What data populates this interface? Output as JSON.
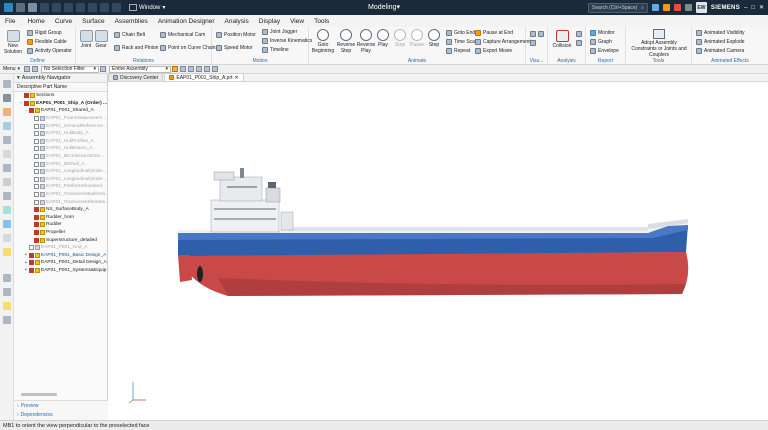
{
  "titlebar": {
    "window_menu": "Window",
    "app_mode": "Modeling",
    "search_placeholder": "Search (Ctrl+Space)",
    "user_initials": "EW",
    "brand": "SIEMENS"
  },
  "menu": [
    "File",
    "Home",
    "Curve",
    "Surface",
    "Assemblies",
    "Animation Designer",
    "Analysis",
    "Display",
    "View",
    "Tools"
  ],
  "ribbon": {
    "define": {
      "label": "Define",
      "new_solution": "New Solution",
      "rigid_group": "Rigid Group",
      "flexible_cable": "Flexible Cable",
      "activity_operator": "Activity Operator"
    },
    "relations": {
      "label": "Relations",
      "joint": "Joint",
      "gear": "Gear",
      "chain_belt": "Chain Belt",
      "rack_pinion": "Rack and Pinion",
      "mechanical_cam": "Mechanical Cam",
      "point_on_curve_chain": "Point on Curve Chain"
    },
    "motion": {
      "label": "Motion",
      "position_motor": "Position Motor",
      "speed_motor": "Speed Motor",
      "joint_jogger": "Joint Jogger",
      "inverse_kinematics": "Inverse Kinematics",
      "timeline": "Timeline"
    },
    "animate": {
      "label": "Animate",
      "goto_beginning": "Goto Beginning",
      "reverse_step": "Reverse Step",
      "reverse_play": "Reverse Play",
      "play": "Play",
      "stop": "Stop",
      "pause": "Pause",
      "step": "Step",
      "goto_end": "Goto End",
      "time_scale": "Time Scale",
      "repeat": "Repeat",
      "pause_at_end": "Pause at End",
      "capture_arrangement": "Capture Arrangement",
      "export_movie": "Export Movie"
    },
    "visualization": {
      "label": "Visu..."
    },
    "analysis": {
      "label": "Analysis",
      "collision": "Collision"
    },
    "report": {
      "label": "Report",
      "monitor": "Monitor",
      "graph": "Graph",
      "envelope": "Envelope"
    },
    "tools": {
      "label": "Tools",
      "adopt": "Adopt Assembly Constraints or Joints and Couplers"
    },
    "animated_effects": {
      "label": "Animated Effects",
      "visibility": "Animated Visibility",
      "explode": "Animated Explode",
      "camera": "Animated Camera"
    }
  },
  "selection_bar": {
    "menu": "Menu",
    "filter": "No Selection Filter",
    "scope": "Entire Assembly"
  },
  "navigator": {
    "title": "Assembly Navigator",
    "column": "Descriptive Part Name",
    "rows": [
      {
        "label": "Sections",
        "indent": 1,
        "state": "normal",
        "toggle": ""
      },
      {
        "label": "EAP01_P001_Ship_A (Order) ...",
        "indent": 1,
        "state": "bold",
        "toggle": "-"
      },
      {
        "label": "EAP01_P001_Shared_A",
        "indent": 2,
        "state": "normal",
        "toggle": "-"
      },
      {
        "label": "EAP01_FrameDataAssem...",
        "indent": 3,
        "state": "dim",
        "toggle": ""
      },
      {
        "label": "EAP01_GeneralReference...",
        "indent": 3,
        "state": "dim",
        "toggle": ""
      },
      {
        "label": "EAP01_HullBody_A",
        "indent": 3,
        "state": "dim",
        "toggle": ""
      },
      {
        "label": "EAP01_HullProfiles_A",
        "indent": 3,
        "state": "dim",
        "toggle": ""
      },
      {
        "label": "EAP01_HullBeams_A",
        "indent": 3,
        "state": "dim",
        "toggle": ""
      },
      {
        "label": "EAP01_IBCrossSectDom...",
        "indent": 3,
        "state": "dim",
        "toggle": ""
      },
      {
        "label": "EAP01_IBShell_A",
        "indent": 3,
        "state": "dim",
        "toggle": ""
      },
      {
        "label": "EAP01_LongitudinalGirder...",
        "indent": 3,
        "state": "dim",
        "toggle": ""
      },
      {
        "label": "EAP01_LongitudinalGirder...",
        "indent": 3,
        "state": "dim",
        "toggle": ""
      },
      {
        "label": "EAP01_PlatformSheetand...",
        "indent": 3,
        "state": "dim",
        "toggle": ""
      },
      {
        "label": "EAP01_TransverseBulkhea...",
        "indent": 3,
        "state": "dim",
        "toggle": ""
      },
      {
        "label": "EAP01_TransverseSheetas...",
        "indent": 3,
        "state": "dim",
        "toggle": ""
      },
      {
        "label": "NX_SurfaceBody_A",
        "indent": 3,
        "state": "normal",
        "toggle": ""
      },
      {
        "label": "Rudder_horn",
        "indent": 3,
        "state": "normal",
        "toggle": ""
      },
      {
        "label": "Rudder",
        "indent": 3,
        "state": "normal",
        "toggle": ""
      },
      {
        "label": "Propeller",
        "indent": 3,
        "state": "normal",
        "toggle": ""
      },
      {
        "label": "Superstructure_detailed",
        "indent": 3,
        "state": "normal",
        "toggle": ""
      },
      {
        "label": "EAP01_P001_Grid_A",
        "indent": 2,
        "state": "dim",
        "toggle": ""
      },
      {
        "label": "EAP01_P001_Basic Design_A",
        "indent": 2,
        "state": "sel",
        "toggle": "+"
      },
      {
        "label": "EAP01_P001_Detail Design_A",
        "indent": 2,
        "state": "normal",
        "toggle": "+"
      },
      {
        "label": "EAP01_P001_Systems&Equip...",
        "indent": 2,
        "state": "normal",
        "toggle": "+"
      }
    ],
    "preview": "Preview",
    "dependencies": "Dependencies"
  },
  "tabs": [
    {
      "label": "Discovery Center",
      "active": false
    },
    {
      "label": "EAP01_P001_Ship_A.prt",
      "active": true
    }
  ],
  "status": "MB1 to orient the view perpendicular to the preselected face",
  "colors": {
    "titlebar": "#1b2a3a",
    "hull_blue": "#2f5faa",
    "hull_red": "#c94848",
    "deck_white": "#eef1f4",
    "ribbon_label": "#2b6cb0"
  }
}
